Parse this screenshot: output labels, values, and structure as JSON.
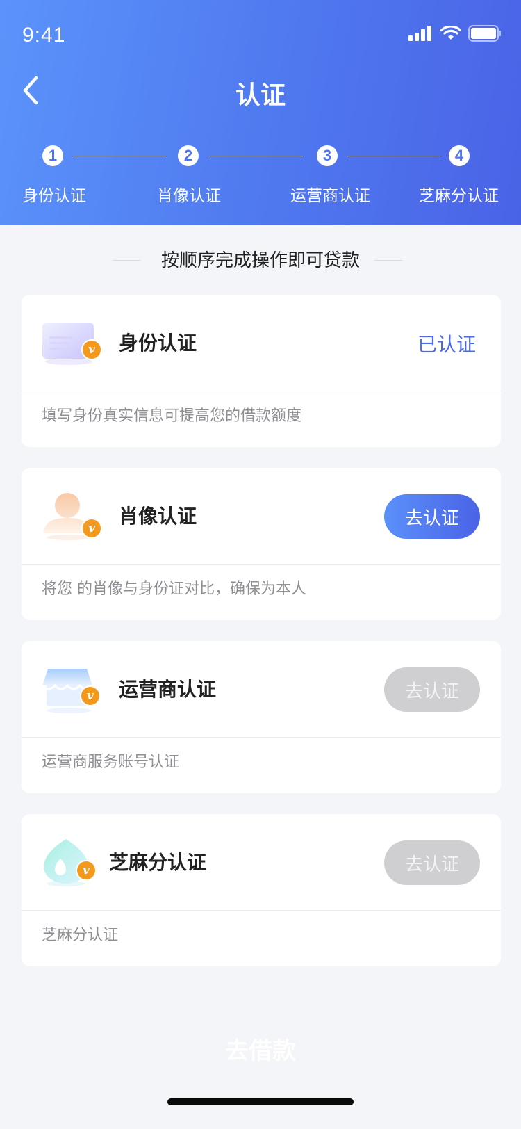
{
  "status_bar": {
    "time": "9:41"
  },
  "header": {
    "title": "认证"
  },
  "steps": [
    {
      "number": "1",
      "label": "身份认证"
    },
    {
      "number": "2",
      "label": "肖像认证"
    },
    {
      "number": "3",
      "label": "运营商认证"
    },
    {
      "number": "4",
      "label": "芝麻分认证"
    }
  ],
  "section_title": "按顺序完成操作即可贷款",
  "cards": [
    {
      "title": "身份认证",
      "desc": "填写身份真实信息可提高您的借款额度",
      "status": "已认证",
      "icon": "id-card-icon"
    },
    {
      "title": "肖像认证",
      "desc": "将您 的肖像与身份证对比，确保为本人",
      "action": "去认证",
      "icon": "portrait-icon"
    },
    {
      "title": "运营商认证",
      "desc": "运营商服务账号认证",
      "action": "去认证",
      "icon": "carrier-store-icon"
    },
    {
      "title": "芝麻分认证",
      "desc": "芝麻分认证",
      "action": "去认证",
      "icon": "sesame-drop-icon"
    }
  ],
  "badge_letter": "v",
  "colors": {
    "primary": "#4e69e8",
    "badge": "#f39a1e",
    "disabled": "#cfcfd1"
  },
  "footer": {
    "borrow_label": "去借款"
  }
}
